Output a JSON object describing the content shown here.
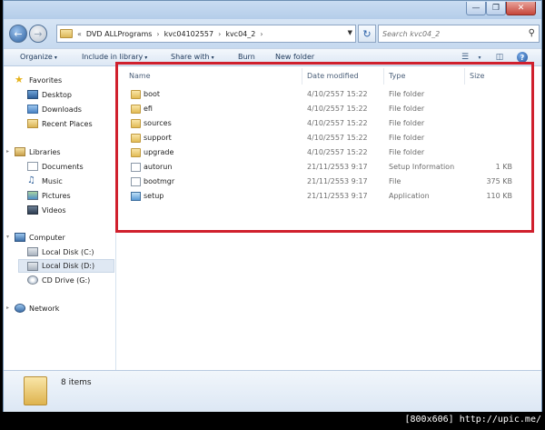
{
  "window": {
    "controls": {
      "minimize": "—",
      "maximize": "❐",
      "close": "✕"
    }
  },
  "address": {
    "history_glyph": "«",
    "crumbs": [
      "DVD ALLPrograms",
      "kvc04102557",
      "kvc04_2"
    ],
    "separator": "›",
    "dropdown": "▼",
    "refresh": "↻",
    "search_placeholder": "Search kvc04_2"
  },
  "toolbar": {
    "organize": "Organize",
    "include": "Include in library",
    "share": "Share with",
    "burn": "Burn",
    "new_folder": "New folder",
    "arrow": "▾",
    "help": "?"
  },
  "nav": {
    "favorites": {
      "label": "Favorites",
      "items": [
        "Desktop",
        "Downloads",
        "Recent Places"
      ]
    },
    "libraries": {
      "label": "Libraries",
      "items": [
        "Documents",
        "Music",
        "Pictures",
        "Videos"
      ]
    },
    "computer": {
      "label": "Computer",
      "items": [
        "Local Disk (C:)",
        "Local Disk (D:)",
        "CD Drive (G:)"
      ]
    },
    "network": {
      "label": "Network"
    }
  },
  "columns": {
    "name": "Name",
    "date": "Date modified",
    "type": "Type",
    "size": "Size"
  },
  "files": [
    {
      "name": "boot",
      "date": "4/10/2557 15:22",
      "type": "File folder",
      "size": "",
      "icon": "folder"
    },
    {
      "name": "efi",
      "date": "4/10/2557 15:22",
      "type": "File folder",
      "size": "",
      "icon": "folder"
    },
    {
      "name": "sources",
      "date": "4/10/2557 15:22",
      "type": "File folder",
      "size": "",
      "icon": "folder"
    },
    {
      "name": "support",
      "date": "4/10/2557 15:22",
      "type": "File folder",
      "size": "",
      "icon": "folder"
    },
    {
      "name": "upgrade",
      "date": "4/10/2557 15:22",
      "type": "File folder",
      "size": "",
      "icon": "folder"
    },
    {
      "name": "autorun",
      "date": "21/11/2553 9:17",
      "type": "Setup Information",
      "size": "1 KB",
      "icon": "doc"
    },
    {
      "name": "bootmgr",
      "date": "21/11/2553 9:17",
      "type": "File",
      "size": "375 KB",
      "icon": "doc"
    },
    {
      "name": "setup",
      "date": "21/11/2553 9:17",
      "type": "Application",
      "size": "110 KB",
      "icon": "app"
    }
  ],
  "details": {
    "count": "8 items"
  },
  "watermark": "[800x606] http://upic.me/",
  "colors": {
    "highlight_box": "#d0202d",
    "window_frame": "#dfe9f5"
  }
}
